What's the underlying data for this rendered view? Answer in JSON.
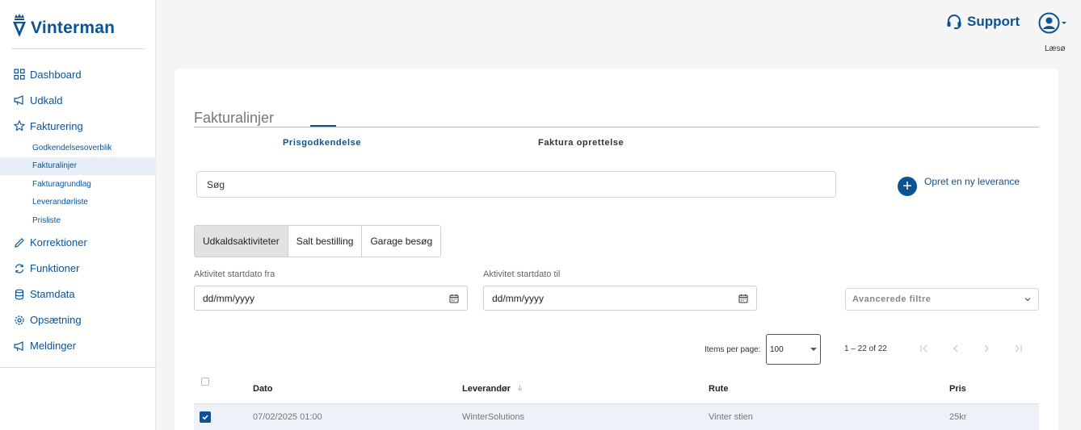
{
  "app": {
    "name": "Vinterman"
  },
  "sidebar": {
    "items": [
      {
        "label": "Dashboard",
        "icon": "grid-icon"
      },
      {
        "label": "Udkald",
        "icon": "megaphone-icon"
      },
      {
        "label": "Fakturering",
        "icon": "star-icon"
      },
      {
        "label": "Korrektioner",
        "icon": "pencil-icon"
      },
      {
        "label": "Funktioner",
        "icon": "refresh-icon"
      },
      {
        "label": "Stamdata",
        "icon": "database-icon"
      },
      {
        "label": "Opsætning",
        "icon": "gear-icon"
      },
      {
        "label": "Meldinger",
        "icon": "megaphone-icon"
      }
    ],
    "subitems": [
      {
        "label": "Godkendelsesoverblik"
      },
      {
        "label": "Fakturalinjer",
        "active": true
      },
      {
        "label": "Fakturagrundlag"
      },
      {
        "label": "Leverandørliste"
      },
      {
        "label": "Prisliste"
      }
    ]
  },
  "header": {
    "support_label": "Support",
    "account_name": "Læsø"
  },
  "main": {
    "title": "Fakturalinjer",
    "tabs": [
      {
        "label": "Prisgodkendelse",
        "active": true
      },
      {
        "label": "Faktura oprettelse",
        "active": false
      }
    ],
    "search_placeholder": "Søg",
    "create_label": "Opret en ny leverance",
    "segments": [
      {
        "label": "Udkaldsaktiviteter",
        "active": true
      },
      {
        "label": "Salt bestilling",
        "active": false
      },
      {
        "label": "Garage besøg",
        "active": false
      }
    ],
    "filters": {
      "start_from_label": "Aktivitet startdato fra",
      "start_from_value": "dd/mm/yyyy",
      "start_to_label": "Aktivitet startdato til",
      "start_to_value": "dd/mm/yyyy",
      "advanced_label": "Avancerede filtre"
    },
    "pagination": {
      "items_per_page_label": "Items per page:",
      "items_per_page_value": "100",
      "range": "1 – 22 of 22"
    },
    "table": {
      "columns": [
        "Dato",
        "Leverandør",
        "Rute",
        "Pris"
      ],
      "rows": [
        {
          "checked": true,
          "cells": [
            "07/02/2025 01:00",
            "WinterSolutions",
            "Vinter stien",
            "25kr"
          ]
        }
      ]
    }
  },
  "colors": {
    "brand": "#0b5394",
    "selected_row": "#eef1f7"
  }
}
